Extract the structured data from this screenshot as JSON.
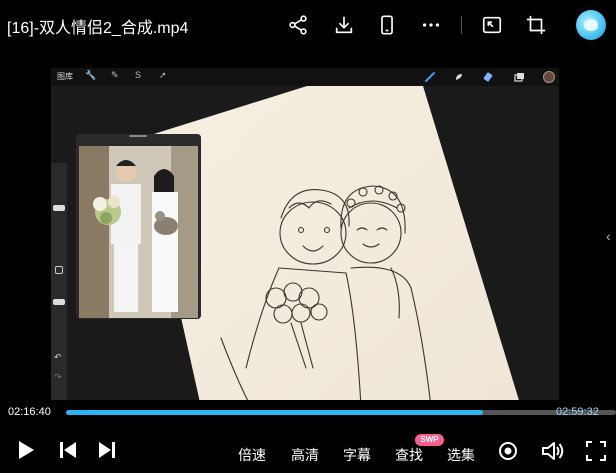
{
  "window": {
    "title": "[16]-双人情侣2_合成.mp4"
  },
  "top_icons": [
    "share-icon",
    "download-icon",
    "phone-icon",
    "more-icon",
    "pip-icon",
    "crop-icon",
    "avatar-icon"
  ],
  "app": {
    "gallery_label": "图库",
    "tool_glyphs": [
      "🔧",
      "✎",
      "S",
      "➚"
    ]
  },
  "player": {
    "current_time": "02:16:40",
    "total_time": "02:59:32",
    "progress_fraction": 0.758,
    "accent_color": "#29b6f6",
    "controls": {
      "speed_label": "倍速",
      "quality_label": "高清",
      "subtitle_label": "字幕",
      "search_label": "查找",
      "search_badge": "SWP",
      "episodes_label": "选集"
    }
  }
}
